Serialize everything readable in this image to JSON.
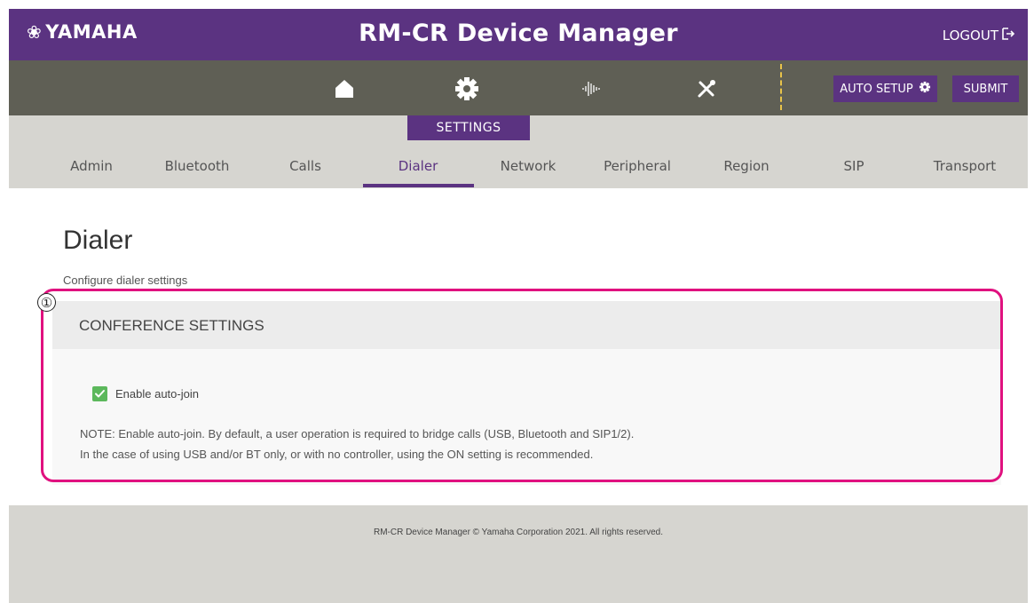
{
  "header": {
    "brand": "YAMAHA",
    "title": "RM-CR Device Manager",
    "logout_label": "LOGOUT"
  },
  "toolbar": {
    "icons": [
      "home-icon",
      "gear-icon",
      "audio-icon",
      "tools-icon"
    ],
    "auto_setup_label": "AUTO SETUP",
    "submit_label": "SUBMIT"
  },
  "section_tab": "SETTINGS",
  "tabs": [
    {
      "label": "Admin"
    },
    {
      "label": "Bluetooth"
    },
    {
      "label": "Calls"
    },
    {
      "label": "Dialer",
      "active": true
    },
    {
      "label": "Network"
    },
    {
      "label": "Peripheral"
    },
    {
      "label": "Region"
    },
    {
      "label": "SIP"
    },
    {
      "label": "Transport"
    }
  ],
  "page": {
    "title": "Dialer",
    "subtitle": "Configure dialer settings"
  },
  "conference": {
    "title": "CONFERENCE SETTINGS",
    "auto_join_label": "Enable auto-join",
    "auto_join_checked": true,
    "note_line1": "NOTE: Enable auto-join. By default, a user operation is required to bridge calls (USB, Bluetooth and SIP1/2).",
    "note_line2": "In the case of using USB and/or BT only, or with no controller, using the ON setting is recommended."
  },
  "annotation": {
    "marker": "①"
  },
  "footer": {
    "text": "RM-CR Device Manager © Yamaha Corporation 2021. All rights reserved."
  },
  "colors": {
    "brand_purple": "#5b3381",
    "toolbar_gray": "#5f5f55",
    "annotation_pink": "#e0117f",
    "check_green": "#5cb85c",
    "divider_gold": "#e8c34a"
  }
}
